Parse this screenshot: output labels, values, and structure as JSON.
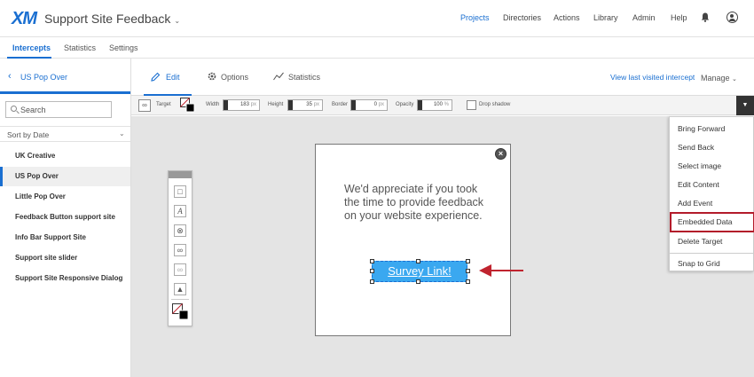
{
  "header": {
    "logo": "XM",
    "project_title": "Support Site Feedback",
    "nav": [
      "Projects",
      "Directories",
      "Actions",
      "Library",
      "Admin",
      "Help"
    ],
    "active_nav": "Projects"
  },
  "subtabs": [
    "Intercepts",
    "Statistics",
    "Settings"
  ],
  "sidebar": {
    "back_label": "US Pop Over",
    "search_placeholder": "Search",
    "sort_label": "Sort by Date",
    "items": [
      {
        "label": "UK Creative"
      },
      {
        "label": "US Pop Over"
      },
      {
        "label": "Little Pop Over"
      },
      {
        "label": "Feedback Button support site"
      },
      {
        "label": "Info Bar Support Site"
      },
      {
        "label": "Support site slider"
      },
      {
        "label": "Support Site Responsive Dialog"
      }
    ],
    "active_item": "US Pop Over"
  },
  "main_tabs": {
    "edit": "Edit",
    "options": "Options",
    "statistics": "Statistics",
    "view_last": "View last visited intercept",
    "manage": "Manage"
  },
  "propbar": {
    "target_label": "Target",
    "width_label": "Width",
    "width_value": "183",
    "height_label": "Height",
    "height_value": "35",
    "border_label": "Border",
    "border_value": "0",
    "opacity_label": "Opacity",
    "opacity_value": "100",
    "px_unit": "px",
    "pct_unit": "%",
    "drop_shadow_label": "Drop shadow"
  },
  "popup": {
    "text": "We'd appreciate if you took the time to provide feedback on your website experience.",
    "link_label": "Survey Link!"
  },
  "context_menu": {
    "items": [
      "Bring Forward",
      "Send Back",
      "Select image",
      "Edit Content",
      "Add Event",
      "Embedded Data",
      "Delete Target",
      "Snap to Grid"
    ],
    "highlighted": "Embedded Data"
  },
  "colors": {
    "accent": "#1a6fd1",
    "highlight": "#b31b2a",
    "link_bg": "#3aa8f0"
  }
}
